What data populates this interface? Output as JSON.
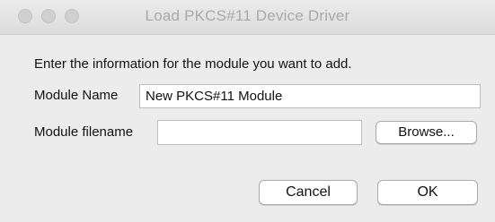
{
  "window": {
    "title": "Load PKCS#11 Device Driver"
  },
  "form": {
    "instruction": "Enter the information for the module you want to add.",
    "module_name_label": "Module Name",
    "module_name_value": "New PKCS#11 Module",
    "module_filename_label": "Module filename",
    "module_filename_value": "",
    "browse_label": "Browse..."
  },
  "actions": {
    "cancel_label": "Cancel",
    "ok_label": "OK"
  }
}
